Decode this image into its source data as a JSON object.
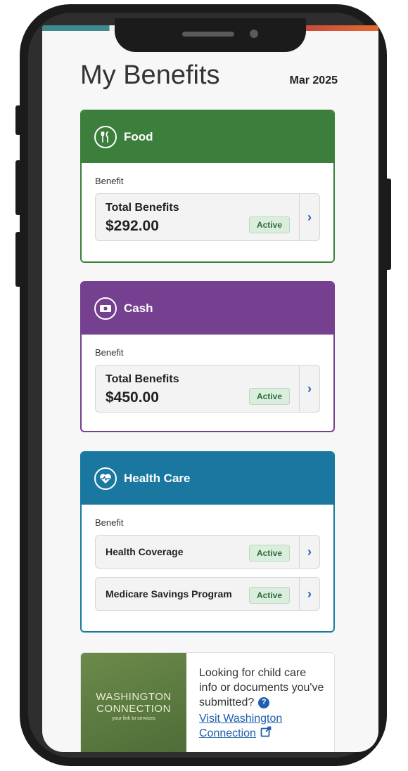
{
  "header": {
    "title": "My Benefits",
    "month": "Mar 2025"
  },
  "food": {
    "title": "Food",
    "color": "#3c7f3c",
    "icon": "utensils-icon",
    "benefit_label": "Benefit",
    "row": {
      "name": "Total Benefits",
      "amount": "$292.00",
      "status": "Active"
    }
  },
  "cash": {
    "title": "Cash",
    "color": "#74408f",
    "icon": "money-icon",
    "benefit_label": "Benefit",
    "row": {
      "name": "Total Benefits",
      "amount": "$450.00",
      "status": "Active"
    }
  },
  "health": {
    "title": "Health Care",
    "color": "#1a78a0",
    "icon": "heart-pulse-icon",
    "benefit_label": "Benefit",
    "rows": [
      {
        "name": "Health Coverage",
        "status": "Active"
      },
      {
        "name": "Medicare Savings Program",
        "status": "Active"
      }
    ]
  },
  "washington": {
    "logo_line1": "WASHINGTON",
    "logo_line2": "CONNECTION",
    "logo_tagline": "your link to services",
    "text": "Looking for child care info or documents you've submitted?",
    "help_label": "?",
    "link_text": "Visit Washington Connection"
  }
}
